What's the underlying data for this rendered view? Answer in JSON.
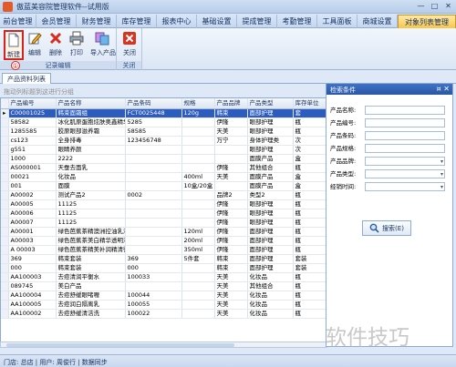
{
  "window": {
    "title": "傲蓝美容院管理软件--试用版",
    "minimize": "—",
    "maximize": "□",
    "close": "✕"
  },
  "menu": {
    "tabs": [
      "前台管理",
      "会员管理",
      "财务管理",
      "库存管理",
      "报表中心",
      "基础设置",
      "提成管理",
      "考勤管理",
      "工具面板",
      "商城设置",
      "对象列表管理"
    ],
    "active_index": 10
  },
  "ribbon": {
    "groups": [
      {
        "caption": "记录编辑",
        "buttons": [
          "新建",
          "编辑",
          "删除",
          "打印",
          "导入产品"
        ]
      },
      {
        "caption": "关闭",
        "buttons": [
          "关闭"
        ]
      }
    ],
    "selected_button": "新建",
    "marker": "①"
  },
  "document_tab": "产品资料列表",
  "group_hint": "拖动列标题到这进行分组",
  "grid": {
    "columns": [
      "",
      "产品编号",
      "产品名称",
      "产品条码",
      "规格",
      "产品品牌",
      "产品类型",
      "库存单位"
    ],
    "rows": [
      [
        "▸",
        "C00001025",
        "韩束面霜组",
        "FCT0025448",
        "120g",
        "韩束",
        "面部护理",
        "套"
      ],
      [
        "",
        "58582",
        "冰化肌原蛋胞炫肤奥鑫精华",
        "5285",
        "",
        "伊隆",
        "眼部护理",
        "瓶"
      ],
      [
        "",
        "1285585",
        "胶原眼部滋养霜",
        "58585",
        "",
        "天美",
        "眼部护理",
        "瓶"
      ],
      [
        "",
        "cs123",
        "全身排毒",
        "123456748",
        "",
        "万宁",
        "身体护理类",
        "次"
      ],
      [
        "",
        "g551",
        "眼睛养颜",
        "",
        "",
        "",
        "眼部护理",
        "次"
      ],
      [
        "",
        "1000",
        "2222",
        "",
        "",
        "",
        "面膜产品",
        "盒"
      ],
      [
        "",
        "AS000001",
        "天蚕去面乳",
        "",
        "",
        "伊隆",
        "其他组合",
        "瓶"
      ],
      [
        "",
        "00021",
        "化妆品",
        "",
        "400ml",
        "天美",
        "面膜产品",
        "盒"
      ],
      [
        "",
        "001",
        "面膜",
        "",
        "10盒/20盒",
        "",
        "面膜产品",
        "盒"
      ],
      [
        "",
        "A00002",
        "测试产品2",
        "0002",
        "",
        "品牌2",
        "类型2",
        "瓶"
      ],
      [
        "",
        "A00005",
        "11125",
        "",
        "",
        "伊隆",
        "眼部护理",
        "瓶"
      ],
      [
        "",
        "A00006",
        "11125",
        "",
        "",
        "伊隆",
        "眼部护理",
        "瓶"
      ],
      [
        "",
        "A00007",
        "11125",
        "",
        "",
        "伊隆",
        "眼部护理",
        "瓶"
      ],
      [
        "",
        "A00001",
        "绿色芭蕉茶精澳洲控油乳液 500g",
        "",
        "120ml",
        "伊隆",
        "面部护理",
        "瓶"
      ],
      [
        "",
        "A00003",
        "绿色芭蕉茶美白精华透明液 500g",
        "",
        "200ml",
        "伊隆",
        "面部护理",
        "瓶"
      ],
      [
        "",
        "A 00003",
        "绿色芭蕉茶精美补润精清微液 500g",
        "",
        "350ml",
        "伊隆",
        "面部护理",
        "瓶"
      ],
      [
        "",
        "369",
        "韩束套装",
        "369",
        "5件套",
        "韩束",
        "面部护理",
        "套装"
      ],
      [
        "",
        "000",
        "韩束套装",
        "000",
        "",
        "韩束",
        "面部护理",
        "套装"
      ],
      [
        "",
        "AA100003",
        "去痘清润平衡水",
        "100033",
        "",
        "天美",
        "化妆品",
        "瓶"
      ],
      [
        "",
        "089745",
        "美白产品",
        "",
        "",
        "天美",
        "其他组合",
        "瓶"
      ],
      [
        "",
        "AA100004",
        "去痘舒缓眼啫喱",
        "100044",
        "",
        "天美",
        "化妆品",
        "瓶"
      ],
      [
        "",
        "AA100005",
        "去痘润白隔离乳",
        "100055",
        "",
        "天美",
        "化妆品",
        "瓶"
      ],
      [
        "",
        "AA100002",
        "去痘舒缓清洁洗",
        "100022",
        "",
        "天美",
        "化妆品",
        "瓶"
      ]
    ]
  },
  "search_panel": {
    "title": "检索条件",
    "pin": "¤ ✕",
    "fields": [
      {
        "label": "产品名称:",
        "dropdown": false
      },
      {
        "label": "产品编号:",
        "dropdown": false
      },
      {
        "label": "产品条码:",
        "dropdown": false
      },
      {
        "label": "产品规格:",
        "dropdown": false
      },
      {
        "label": "产品品牌:",
        "dropdown": true
      },
      {
        "label": "产品类型:",
        "dropdown": true
      },
      {
        "label": "经销时间:",
        "dropdown": true
      }
    ],
    "search_button": "搜索(E)"
  },
  "watermark": "软件技巧",
  "status": "门店: 总店 | 用户: 周俊行 | 数据同步"
}
